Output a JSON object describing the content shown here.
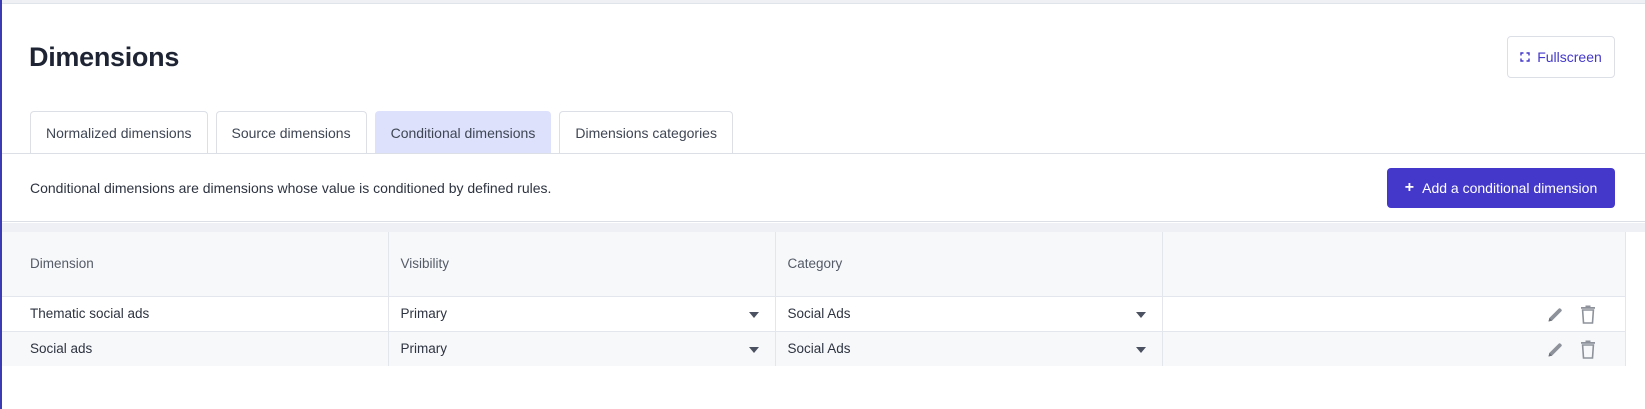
{
  "page": {
    "title": "Dimensions",
    "fullscreen_label": "Fullscreen"
  },
  "tabs": [
    {
      "label": "Normalized dimensions",
      "active": false
    },
    {
      "label": "Source dimensions",
      "active": false
    },
    {
      "label": "Conditional dimensions",
      "active": true
    },
    {
      "label": "Dimensions categories",
      "active": false
    }
  ],
  "description": "Conditional dimensions are dimensions whose value is conditioned by defined rules.",
  "add_button": {
    "icon": "plus-icon",
    "label": "Add a conditional dimension"
  },
  "table": {
    "columns": [
      "Dimension",
      "Visibility",
      "Category",
      ""
    ],
    "rows": [
      {
        "dimension": "Thematic social ads",
        "visibility": "Primary",
        "category": "Social Ads"
      },
      {
        "dimension": "Social ads",
        "visibility": "Primary",
        "category": "Social Ads"
      }
    ],
    "row_actions": [
      "edit-pencil-icon",
      "delete-trash-icon"
    ]
  },
  "colors": {
    "accent": "#4338ca",
    "active_tab_bg": "#dde1fb",
    "header_bg": "#f7f8fa",
    "border": "#dcdfe6"
  }
}
